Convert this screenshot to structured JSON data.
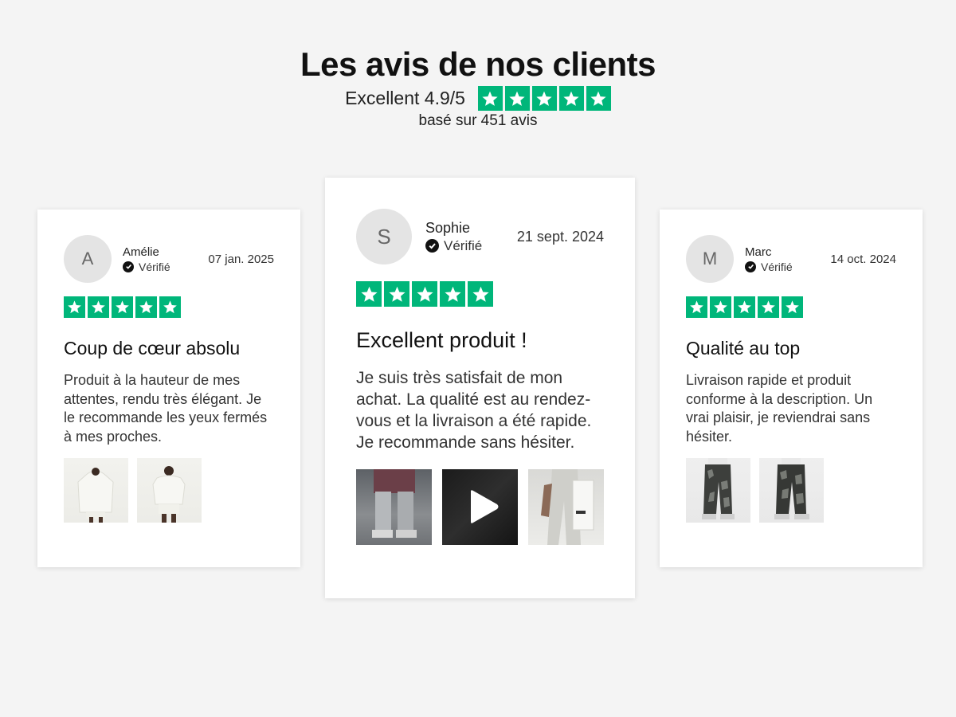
{
  "header": {
    "title": "Les avis de nos clients",
    "rating_text": "Excellent 4.9/5",
    "rating_value": 4.9,
    "rating_max": 5,
    "based_on": "basé sur 451 avis"
  },
  "colors": {
    "star_green": "#00b67a",
    "background": "#f4f4f4",
    "card": "#ffffff"
  },
  "reviews": [
    {
      "initial": "A",
      "name": "Amélie",
      "verified_label": "Vérifié",
      "date": "07 jan. 2025",
      "stars": 5,
      "title": "Coup de cœur absolu",
      "body": "Produit à la hauteur de mes attentes, rendu très élégant. Je le recommande les yeux fermés à mes proches.",
      "media": [
        "hoodie-photo",
        "hoodie-photo"
      ]
    },
    {
      "initial": "S",
      "name": "Sophie",
      "verified_label": "Vérifié",
      "date": "21 sept. 2024",
      "stars": 5,
      "title": "Excellent produit !",
      "body": "Je suis très satisfait de mon achat. La qualité est au rendez-vous et la livraison a été rapide. Je recommande sans hésiter.",
      "media": [
        "shorts-photo",
        "video-play-icon",
        "joggers-photo"
      ]
    },
    {
      "initial": "M",
      "name": "Marc",
      "verified_label": "Vérifié",
      "date": "14 oct. 2024",
      "stars": 5,
      "title": "Qualité au top",
      "body": "Livraison rapide et produit conforme à la description. Un vrai plaisir, je reviendrai sans hésiter.",
      "media": [
        "camo-pants-photo",
        "camo-pants-photo"
      ]
    }
  ]
}
